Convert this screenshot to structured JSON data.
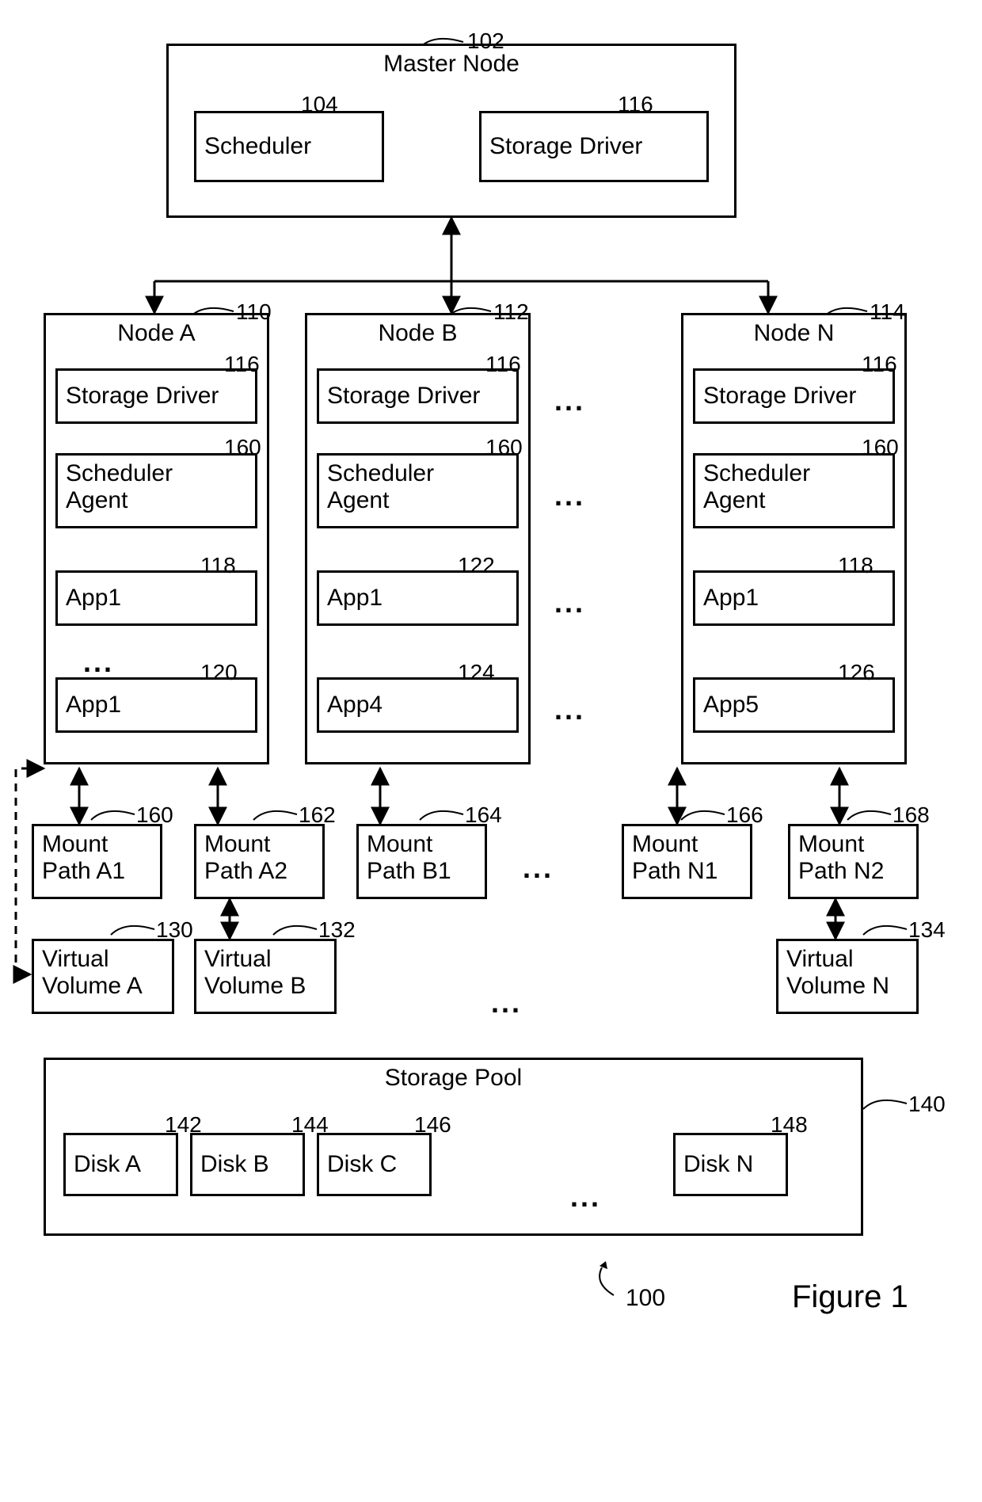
{
  "figure": {
    "label": "Figure 1",
    "system_ref": "100"
  },
  "master": {
    "title": "Master Node",
    "ref": "102",
    "scheduler": {
      "label": "Scheduler",
      "ref": "104"
    },
    "storage_driver": {
      "label": "Storage Driver",
      "ref": "116"
    }
  },
  "nodes": {
    "a": {
      "title": "Node A",
      "ref": "110",
      "storage_driver": {
        "label": "Storage Driver",
        "ref": "116"
      },
      "scheduler_agent": {
        "label": "Scheduler\nAgent",
        "ref": "160"
      },
      "app1": {
        "label": "App1",
        "ref": "118"
      },
      "app2": {
        "label": "App1",
        "ref": "120"
      }
    },
    "b": {
      "title": "Node B",
      "ref": "112",
      "storage_driver": {
        "label": "Storage Driver",
        "ref": "116"
      },
      "scheduler_agent": {
        "label": "Scheduler\nAgent",
        "ref": "160"
      },
      "app1": {
        "label": "App1",
        "ref": "122"
      },
      "app2": {
        "label": "App4",
        "ref": "124"
      }
    },
    "n": {
      "title": "Node N",
      "ref": "114",
      "storage_driver": {
        "label": "Storage Driver",
        "ref": "116"
      },
      "scheduler_agent": {
        "label": "Scheduler\nAgent",
        "ref": "160"
      },
      "app1": {
        "label": "App1",
        "ref": "118"
      },
      "app2": {
        "label": "App5",
        "ref": "126"
      }
    }
  },
  "mounts": {
    "a1": {
      "label": "Mount\nPath A1",
      "ref": "160"
    },
    "a2": {
      "label": "Mount\nPath A2",
      "ref": "162"
    },
    "b1": {
      "label": "Mount\nPath B1",
      "ref": "164"
    },
    "n1": {
      "label": "Mount\nPath N1",
      "ref": "166"
    },
    "n2": {
      "label": "Mount\nPath N2",
      "ref": "168"
    }
  },
  "volumes": {
    "a": {
      "label": "Virtual\nVolume A",
      "ref": "130"
    },
    "b": {
      "label": "Virtual\nVolume B",
      "ref": "132"
    },
    "n": {
      "label": "Virtual\nVolume N",
      "ref": "134"
    }
  },
  "storage_pool": {
    "title": "Storage Pool",
    "ref": "140",
    "disks": {
      "a": {
        "label": "Disk A",
        "ref": "142"
      },
      "b": {
        "label": "Disk B",
        "ref": "144"
      },
      "c": {
        "label": "Disk C",
        "ref": "146"
      },
      "n": {
        "label": "Disk N",
        "ref": "148"
      }
    }
  },
  "ellipsis": "..."
}
